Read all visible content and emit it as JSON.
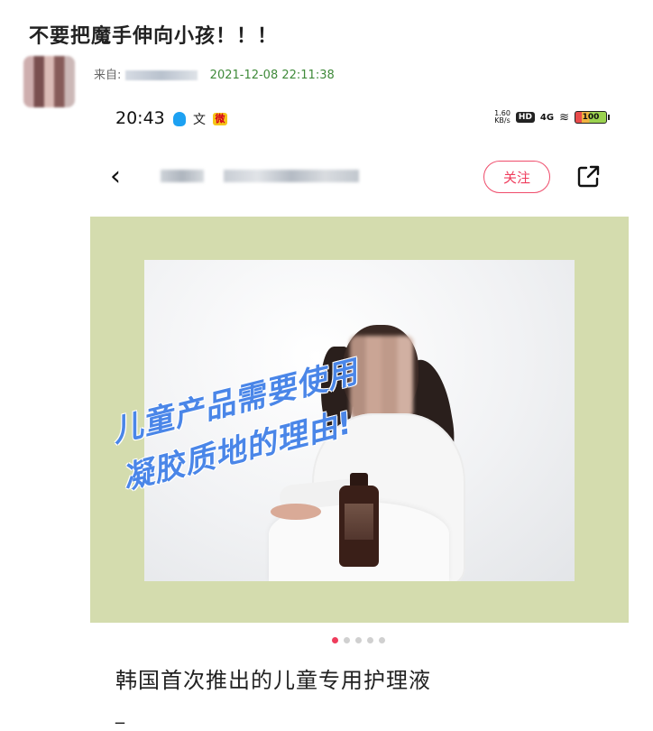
{
  "post": {
    "title": "不要把魔手伸向小孩！！！",
    "from_label": "来自:",
    "timestamp": "2021-12-08 22:11:38"
  },
  "phone": {
    "status_bar": {
      "clock": "20:43",
      "speed_value": "1.60",
      "speed_unit": "KB/s",
      "hd": "HD",
      "signal": "4G",
      "battery": "100"
    },
    "navbar": {
      "follow_label": "关注"
    },
    "image": {
      "caption_line1": "儿童产品需要使用",
      "caption_line2": "凝胶质地的理由!"
    },
    "carousel": {
      "total": 5,
      "active_index": 0
    },
    "headline": "韩国首次推出的儿童专用护理液",
    "dash": "_"
  },
  "colors": {
    "accent": "#ef3c5c",
    "timestamp_green": "#3f8a3a",
    "frame_bg": "#d4dcae",
    "caption_blue": "#4a86e8"
  }
}
